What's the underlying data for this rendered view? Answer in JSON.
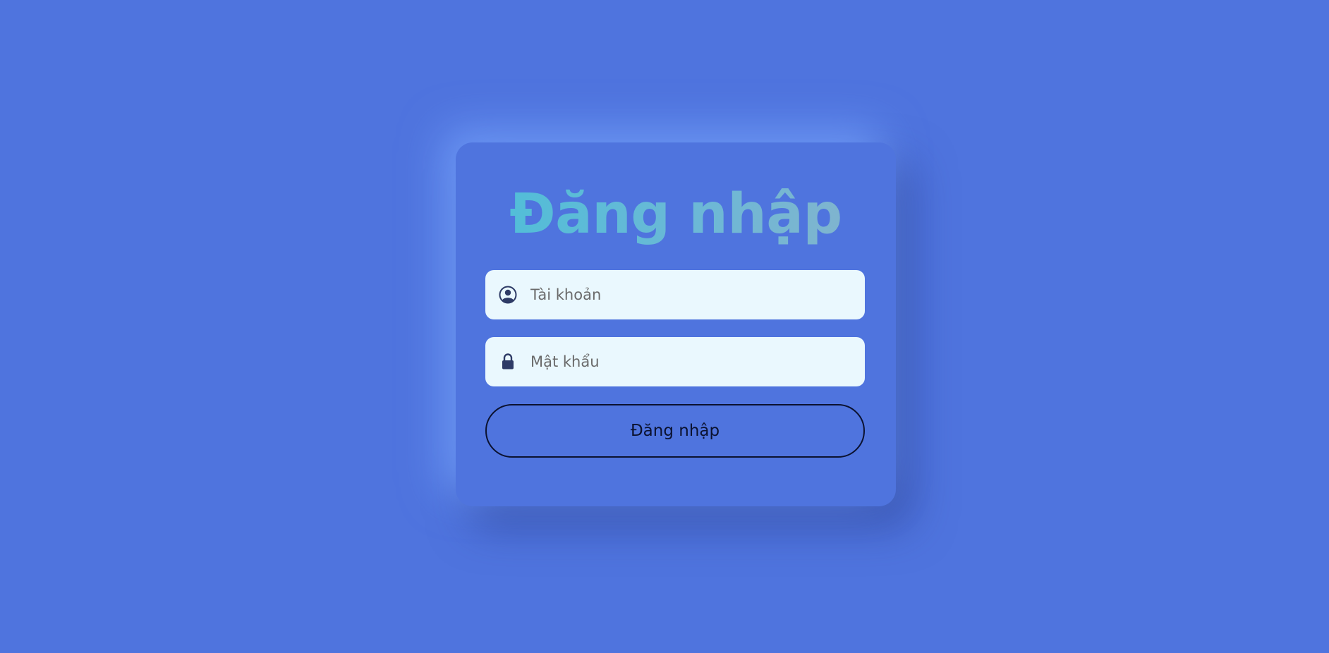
{
  "login": {
    "title": "Đăng nhập",
    "username": {
      "placeholder": "Tài khoản",
      "value": "",
      "icon": "user-circle-icon"
    },
    "password": {
      "placeholder": "Mật khẩu",
      "value": "",
      "icon": "lock-icon"
    },
    "submit_label": "Đăng nhập"
  },
  "colors": {
    "background": "#4f74de",
    "title_gradient_start": "#4bbfd8",
    "title_gradient_end": "#86b3cc",
    "input_background": "#eaf8fe",
    "button_border": "#0b1230",
    "icon_color": "#2e3b66"
  }
}
